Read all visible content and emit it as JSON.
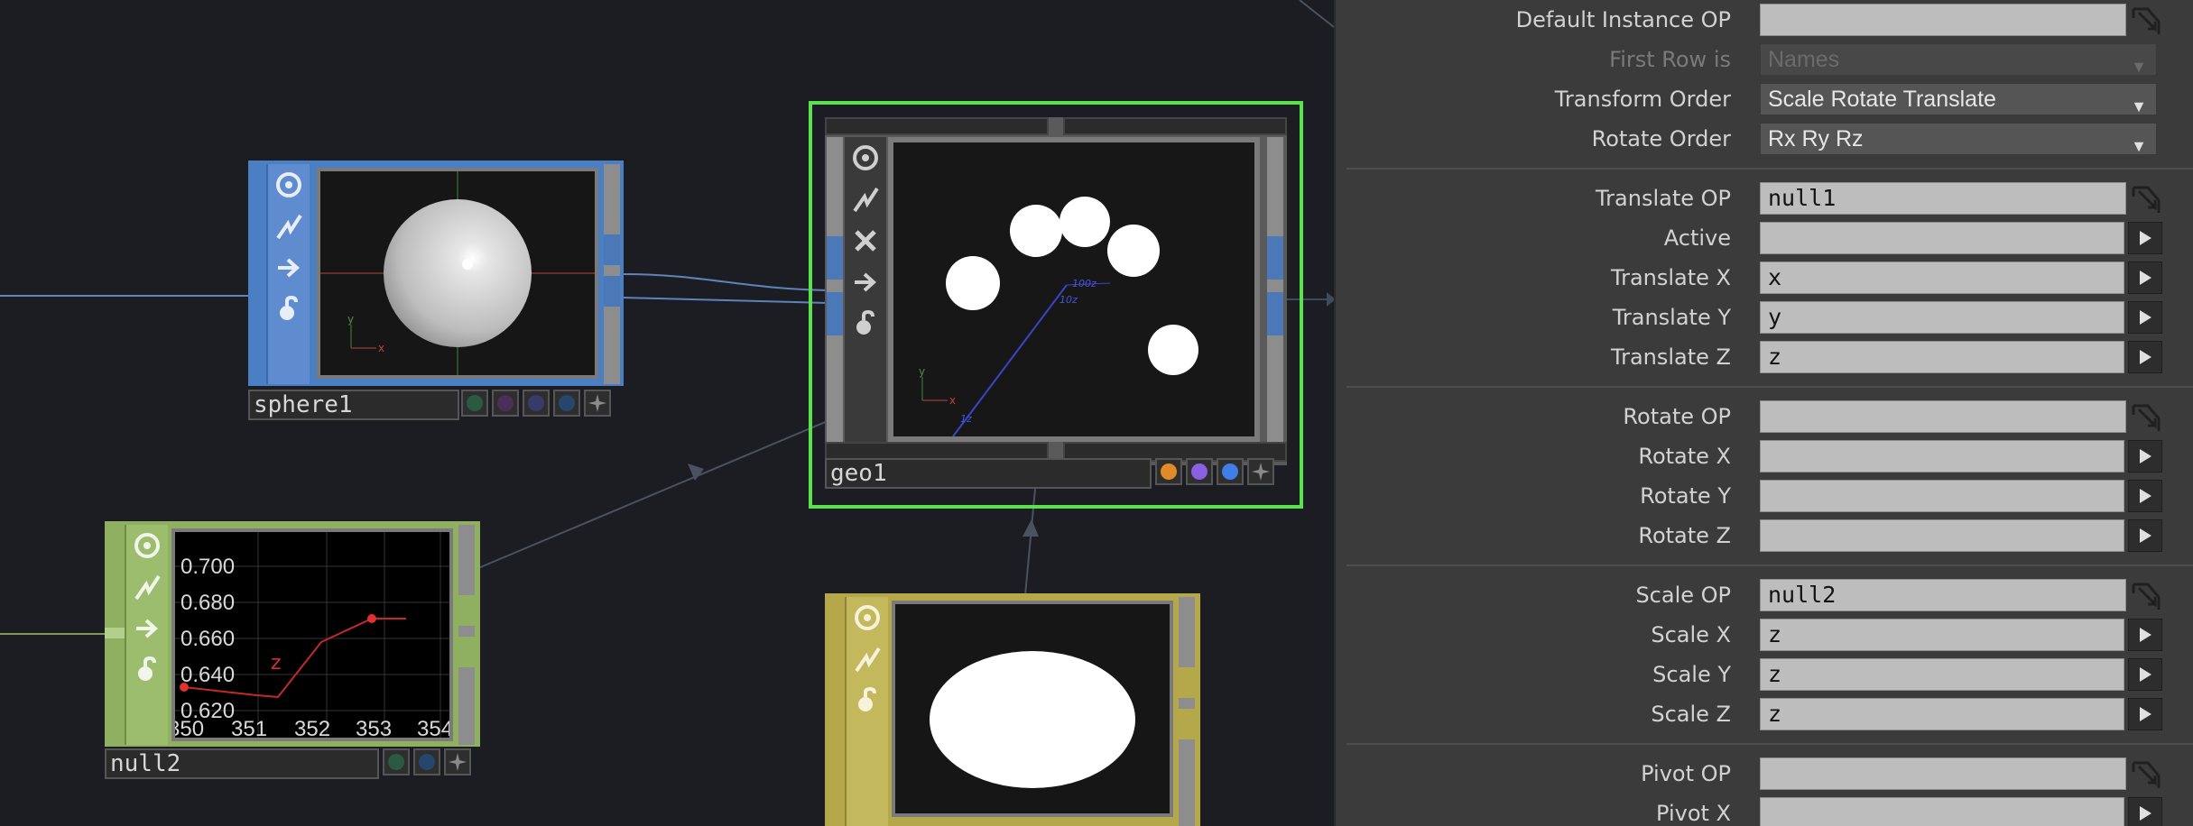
{
  "network": {
    "nodes": {
      "sphere1": {
        "name": "sphere1",
        "axis_y": "y",
        "axis_x": "x"
      },
      "geo1": {
        "name": "geo1",
        "labels": {
          "a": "100z",
          "b": "10z",
          "c": "1z"
        },
        "axis_y": "y",
        "axis_x": "x"
      },
      "null2": {
        "name": "null2",
        "y_ticks": [
          "0.700",
          "0.680",
          "0.660",
          "0.640",
          "0.620"
        ],
        "x_ticks": [
          "350",
          "351",
          "352",
          "353",
          "354"
        ],
        "channel": "z"
      },
      "circle": {
        "name": ""
      }
    },
    "colors": {
      "sop": "#4a7fc4",
      "chop": "#8fb061",
      "top": "#b5a84b",
      "comp_selected": "#5ce04f",
      "dot_orange": "#e08b28",
      "dot_purple": "#8a5fe0",
      "dot_blue": "#3f7ee6"
    }
  },
  "params": {
    "default_instance_op": {
      "label": "Default Instance OP",
      "value": ""
    },
    "first_row_is": {
      "label": "First Row is",
      "value": "Names"
    },
    "transform_order": {
      "label": "Transform Order",
      "value": "Scale Rotate Translate"
    },
    "rotate_order": {
      "label": "Rotate Order",
      "value": "Rx Ry Rz"
    },
    "translate_op": {
      "label": "Translate OP",
      "value": "null1"
    },
    "active": {
      "label": "Active",
      "value": ""
    },
    "translate_x": {
      "label": "Translate X",
      "value": "x"
    },
    "translate_y": {
      "label": "Translate Y",
      "value": "y"
    },
    "translate_z": {
      "label": "Translate Z",
      "value": "z"
    },
    "rotate_op": {
      "label": "Rotate OP",
      "value": ""
    },
    "rotate_x": {
      "label": "Rotate X",
      "value": ""
    },
    "rotate_y": {
      "label": "Rotate Y",
      "value": ""
    },
    "rotate_z": {
      "label": "Rotate Z",
      "value": ""
    },
    "scale_op": {
      "label": "Scale OP",
      "value": "null2"
    },
    "scale_x": {
      "label": "Scale X",
      "value": "z"
    },
    "scale_y": {
      "label": "Scale Y",
      "value": "z"
    },
    "scale_z": {
      "label": "Scale Z",
      "value": "z"
    },
    "pivot_op": {
      "label": "Pivot OP",
      "value": ""
    },
    "pivot_x": {
      "label": "Pivot X",
      "value": ""
    }
  }
}
